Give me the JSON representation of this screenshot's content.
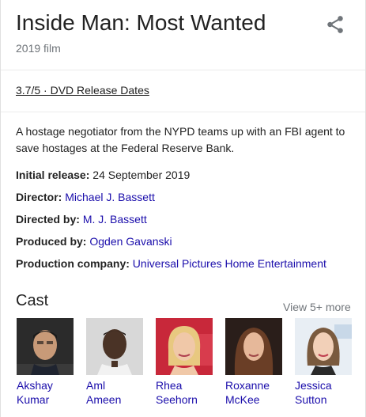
{
  "header": {
    "title": "Inside Man: Most Wanted",
    "subtitle": "2019 film",
    "share_icon": "share-icon"
  },
  "rating": {
    "text": "3.7/5 · DVD Release Dates"
  },
  "description": "A hostage negotiator from the NYPD teams up with an FBI agent to save hostages at the Federal Reserve Bank.",
  "facts": [
    {
      "label": "Initial release:",
      "value": "24 September 2019",
      "link": false
    },
    {
      "label": "Director:",
      "value": "Michael J. Bassett",
      "link": true
    },
    {
      "label": "Directed by:",
      "value": "M. J. Bassett",
      "link": true
    },
    {
      "label": "Produced by:",
      "value": "Ogden Gavanski",
      "link": true
    },
    {
      "label": "Production company:",
      "value": "Universal Pictures Home Entertainment",
      "link": true
    }
  ],
  "cast": {
    "title": "Cast",
    "view_more": "View 5+ more",
    "members": [
      {
        "first": "Akshay",
        "last": "Kumar"
      },
      {
        "first": "Aml",
        "last": "Ameen"
      },
      {
        "first": "Rhea",
        "last": "Seehorn"
      },
      {
        "first": "Roxanne",
        "last": "McKee"
      },
      {
        "first": "Jessica",
        "last": "Sutton"
      }
    ]
  },
  "colors": {
    "link": "#1a0dab",
    "text": "#222222",
    "muted": "#70757a",
    "divider": "#ebebeb"
  }
}
